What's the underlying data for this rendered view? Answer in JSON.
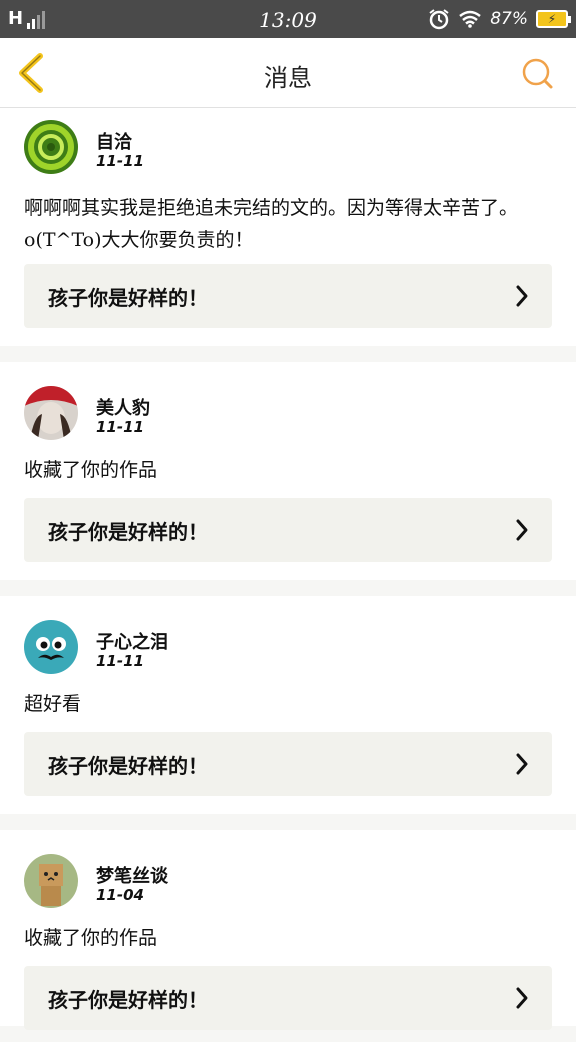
{
  "status_bar": {
    "network": "H",
    "time": "13:09",
    "battery_percent": "87%",
    "icons": [
      "signal-icon",
      "alarm-icon",
      "wifi-icon",
      "battery-icon"
    ]
  },
  "header": {
    "title": "消息",
    "back_icon": "chevron-left-icon",
    "search_icon": "search-icon",
    "accent_color": "#f0a24a",
    "back_color": "#f3c41c"
  },
  "messages": [
    {
      "user": "自洽",
      "date": "11-11",
      "text": "啊啊啊其实我是拒绝追未完结的文的。因为等得太辛苦了。o(T^To)大大你要负责的！",
      "work_title": "孩子你是好样的！"
    },
    {
      "user": "美人豹",
      "date": "11-11",
      "text": "收藏了你的作品",
      "work_title": "孩子你是好样的！"
    },
    {
      "user": "子心之泪",
      "date": "11-11",
      "text": "超好看",
      "work_title": "孩子你是好样的！"
    },
    {
      "user": "梦笔丝谈",
      "date": "11-04",
      "text": "收藏了你的作品",
      "work_title": "孩子你是好样的！"
    }
  ]
}
